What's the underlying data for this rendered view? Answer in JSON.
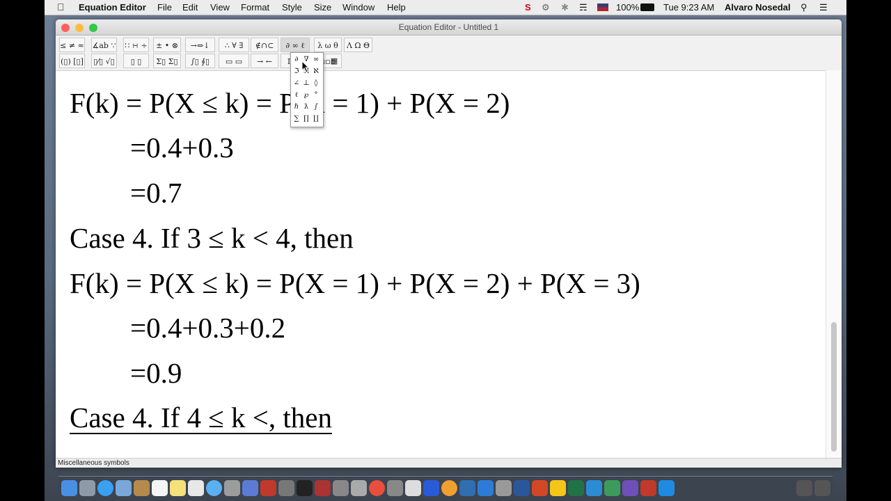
{
  "menubar": {
    "app": "Equation Editor",
    "items": [
      "File",
      "Edit",
      "View",
      "Format",
      "Style",
      "Size",
      "Window",
      "Help"
    ],
    "battery": "100%",
    "clock": "Tue 9:23 AM",
    "user": "Alvaro Nosedal"
  },
  "window": {
    "title": "Equation Editor - Untitled 1",
    "status": "Miscellaneous symbols"
  },
  "palette_row1": [
    "≤ ≠ ≈",
    "∡ab ∵",
    "∷ ∺ ∻",
    "± • ⊗",
    "→⇔↓",
    "∴ ∀ ∃",
    "∉∩⊂",
    "∂ ∞ ℓ",
    "λ ω θ",
    "Λ Ω Θ"
  ],
  "palette_row2": [
    "(▯) [▯]",
    "▯⁄▯ √▯",
    "▯ ▯",
    "Σ▯ Σ▯",
    "∫▯ ∮▯",
    "▭ ▭",
    "→ ←",
    "Π Ũ",
    "▫▫▫",
    "▦"
  ],
  "popup_symbols": [
    "∂",
    "∇",
    "∞",
    "ℑ",
    "ℜ",
    "ℵ",
    "∠",
    "⊥",
    "◊",
    "ℓ",
    "℘",
    "°",
    "ℏ",
    "ƛ",
    "∫",
    "∑",
    "∏",
    "∐"
  ],
  "equations": [
    "F(k) = P(X ≤ k) = P(X = 1) + P(X = 2)",
    "=0.4+0.3",
    "=0.7",
    "Case 4. If 3 ≤ k < 4, then",
    "F(k) = P(X ≤ k) = P(X = 1) + P(X = 2) + P(X = 3)",
    "=0.4+0.3+0.2",
    "=0.9",
    "Case 4. If 4 ≤ k <, then"
  ],
  "colors": {
    "close": "#fc605c",
    "minimize": "#fdbc40",
    "zoom": "#34c84a",
    "accent_red": "#d0021b"
  }
}
